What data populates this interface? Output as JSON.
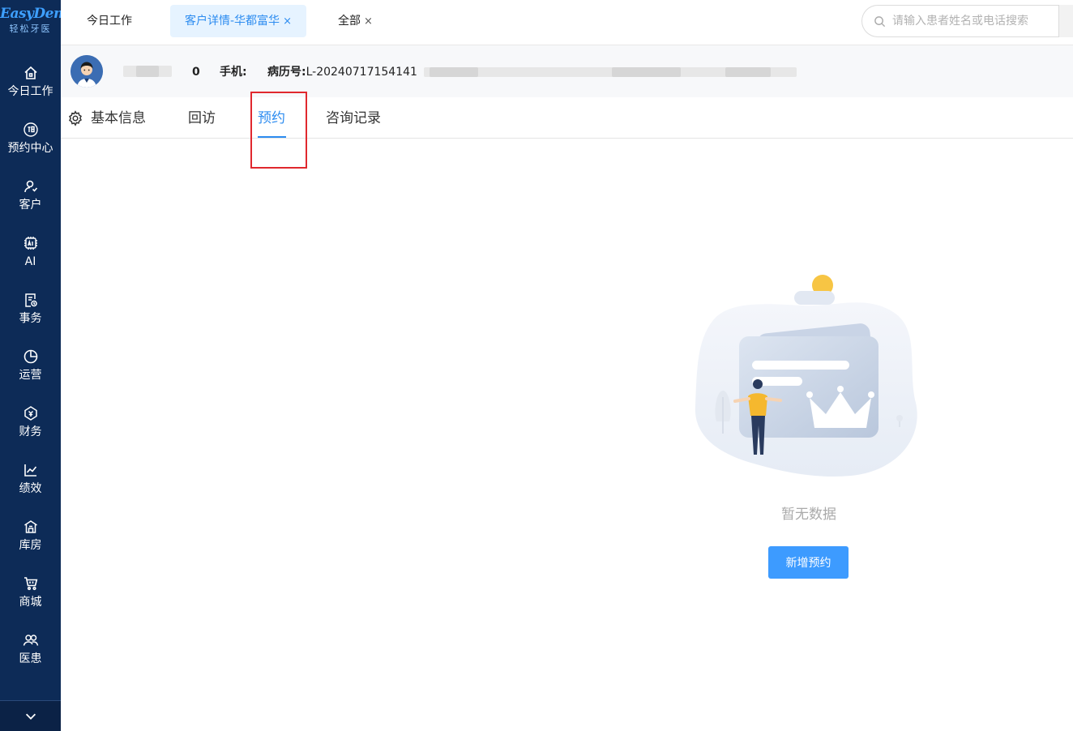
{
  "sidebar": {
    "logo_main": "EasyDent",
    "logo_sub": "轻松牙医",
    "items": [
      {
        "label": "今日工作",
        "icon": "home-icon"
      },
      {
        "label": "预约中心",
        "icon": "appointment-icon"
      },
      {
        "label": "客户",
        "icon": "customer-icon"
      },
      {
        "label": "AI",
        "icon": "ai-chip-icon"
      },
      {
        "label": "事务",
        "icon": "task-icon"
      },
      {
        "label": "运营",
        "icon": "pie-chart-icon"
      },
      {
        "label": "财务",
        "icon": "finance-icon"
      },
      {
        "label": "绩效",
        "icon": "line-chart-icon"
      },
      {
        "label": "库房",
        "icon": "warehouse-icon"
      },
      {
        "label": "商城",
        "icon": "cart-icon"
      },
      {
        "label": "医患",
        "icon": "doctor-patient-icon"
      }
    ],
    "more_icon": "chevron-down-icon"
  },
  "topbar": {
    "tabs": [
      {
        "label": "今日工作",
        "closable": false
      },
      {
        "label": "客户详情-华都富华",
        "closable": true,
        "active": true
      },
      {
        "label": "全部",
        "closable": true
      }
    ],
    "close_glyph": "×",
    "search_placeholder": "请输入患者姓名或电话搜索"
  },
  "patient": {
    "age_value": "0",
    "phone_label": "手机:",
    "record_label": "病历号:",
    "record_value": "L-20240717154141"
  },
  "section_tabs": [
    {
      "label": "基本信息"
    },
    {
      "label": "回访"
    },
    {
      "label": "预约",
      "active": true
    },
    {
      "label": "咨询记录"
    }
  ],
  "empty_state": {
    "text": "暂无数据",
    "button": "新增预约"
  },
  "colors": {
    "sidebar_bg": "#0d2b57",
    "accent": "#2d8cf0",
    "button": "#3d9bff",
    "highlight_box": "#e0282e"
  }
}
